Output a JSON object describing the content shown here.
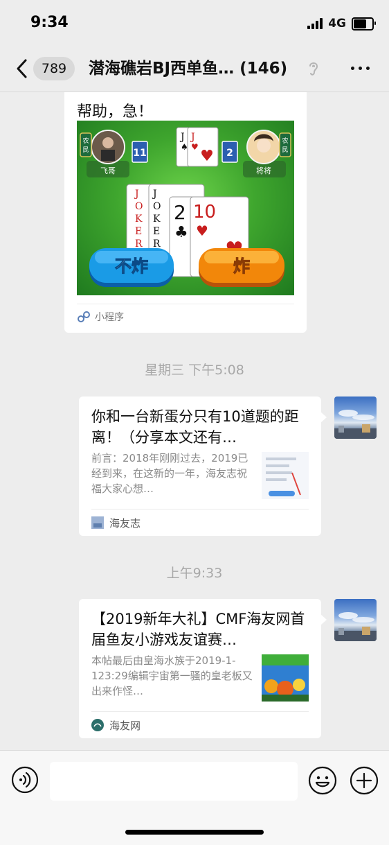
{
  "status": {
    "time": "9:34",
    "network": "4G",
    "battery_level": 0.7
  },
  "nav": {
    "unread_count": "789",
    "title": "潜海礁岩BJ西单鱼…",
    "member_count": "(146)",
    "icons": {
      "back": "chevron-left-icon",
      "mute": "ear-icon",
      "more": "more-dots-icon"
    }
  },
  "messages": {
    "mini_program": {
      "text": "帮助，急！",
      "label": "小程序",
      "game": {
        "player_left": "飞哥",
        "player_right": "将将",
        "role_left": "农民",
        "role_right": "农民",
        "count_left": "11",
        "count_right": "2",
        "button_pass": "不炸",
        "button_bomb": "炸"
      }
    },
    "time_1": "星期三 下午5:08",
    "article_1": {
      "title": "你和一台新蛋分只有10道题的距离！（分享本文还有…",
      "description": "前言：2018年刚刚过去，2019已经到来，在这新的一年，海友志祝福大家心想…",
      "source": "海友志"
    },
    "time_2": "上午9:33",
    "article_2": {
      "title": "【2019新年大礼】CMF海友网首届鱼友小游戏友谊赛…",
      "description": "本帖最后由皇海水族于2019-1-123:29编辑宇宙第一骚的皇老板又出来作怪…",
      "source": "海友网"
    }
  },
  "input_bar": {
    "placeholder": "",
    "icons": {
      "voice": "voice-icon",
      "emoji": "emoji-icon",
      "plus": "plus-icon"
    }
  },
  "colors": {
    "background": "#ededed",
    "bubble": "#ffffff",
    "bomb_orange": "#f2870a",
    "pass_blue": "#1a9be6"
  }
}
